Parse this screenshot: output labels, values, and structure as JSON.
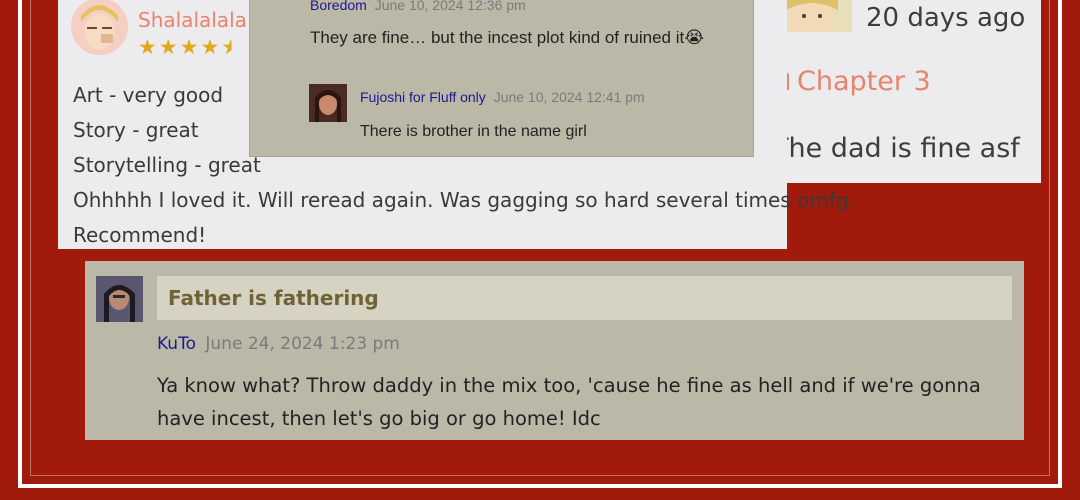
{
  "colors": {
    "background": "#a11a0b",
    "card": "#ececee",
    "comment_card": "#bcb8a8",
    "username_link": "#1a1a8c",
    "accent_orange": "#e8836d",
    "star": "#e3a81e"
  },
  "right_card": {
    "time_ago": "20 days ago",
    "chapter_label": "Chapter 3",
    "chapter_icon": "file-icon",
    "comment": "The dad is fine asf"
  },
  "left_review": {
    "username": "Shalalalala",
    "rating": 4.5,
    "rating_max": 5,
    "lines": [
      "Art - very good",
      "Story - great",
      "Storytelling - great",
      "Ohhhhh I loved it. Will reread again. Was gagging so hard several times omfg.",
      "Recommend!"
    ]
  },
  "mid_comment": {
    "author": "Boredom",
    "date": "June 10, 2024 12:36 pm",
    "text": "They are fine… but the incest plot kind of ruined it",
    "emoji": "😭",
    "reply": {
      "author": "Fujoshi for Fluff only",
      "date": "June 10, 2024 12:41 pm",
      "text": "There is brother in the name girl"
    }
  },
  "bottom_comment": {
    "title": "Father is fathering",
    "author": "KuTo",
    "date": "June 24, 2024 1:23 pm",
    "text": "Ya know what? Throw daddy in the mix too, 'cause he fine as hell and if we're gonna have incest, then let's go big or go home! Idc"
  }
}
